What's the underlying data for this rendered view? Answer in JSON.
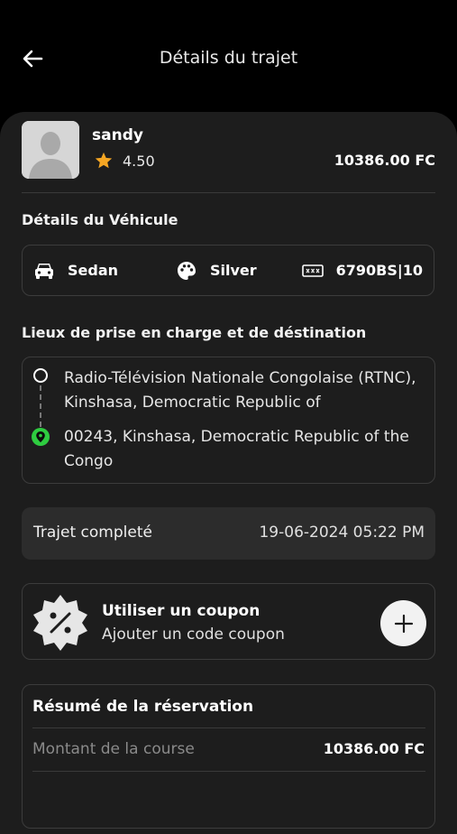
{
  "header": {
    "title": "Détails du trajet",
    "back_icon": "arrow-left-icon"
  },
  "driver": {
    "name": "sandy",
    "rating": "4.50",
    "price": "10386.00 FC",
    "star_color": "#f5a623"
  },
  "vehicle": {
    "section_title": "Détails du Véhicule",
    "type": "Sedan",
    "color": "Silver",
    "plate": "6790BS|10"
  },
  "locations": {
    "section_title": "Lieux de prise en charge et de déstination",
    "pickup": "Radio-Télévision Nationale Congolaise (RTNC), Kinshasa, Democratic Republic of",
    "dropoff": "00243, Kinshasa, Democratic Republic of the Congo",
    "pin_color": "#2ecc40"
  },
  "trip_status": {
    "label": "Trajet completé",
    "date": "19-06-2024 05:22 PM"
  },
  "coupon": {
    "title": "Utiliser un coupon",
    "subtitle": "Ajouter un code coupon"
  },
  "summary": {
    "title": "Résumé de la réservation",
    "fare_label": "Montant de la course",
    "fare_value": "10386.00 FC"
  }
}
